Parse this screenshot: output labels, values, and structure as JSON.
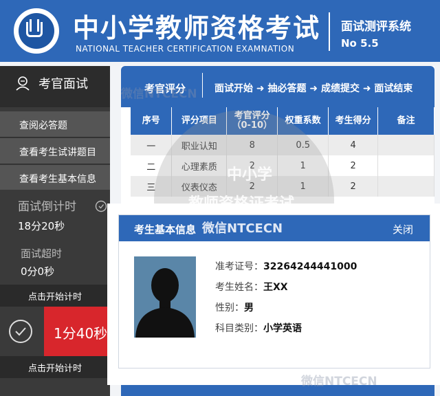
{
  "header": {
    "title_cn": "中小学教师资格考试",
    "title_en": "NATIONAL TEACHER CERTIFICATION EXAMNATION",
    "system_name": "面试测评系统",
    "version": "No 5.5"
  },
  "sidebar": {
    "title": "考官面试",
    "items": [
      {
        "label": "查阅必答题"
      },
      {
        "label": "查看考生试讲题目"
      },
      {
        "label": "查看考生基本信息"
      }
    ],
    "countdown_label": "面试倒计时",
    "countdown_value": "18分20秒",
    "overtime_label": "面试超时",
    "overtime_value": "0分0秒",
    "start_button_1": "点击开始计时",
    "timer_value": "1分40秒",
    "start_button_2": "点击开始计时"
  },
  "panel": {
    "title": "考官评分",
    "steps": "面试开始 ➜ 抽必答题 ➜ 成绩提交 ➜ 面试结束",
    "table": {
      "headers": [
        "序号",
        "评分项目",
        "考官评分",
        "（0-10）",
        "权重系数",
        "考生得分",
        "备注"
      ],
      "rows": [
        [
          "一",
          "职业认知",
          "8",
          "0.5",
          "4",
          ""
        ],
        [
          "二",
          "心理素质",
          "2",
          "1",
          "2",
          ""
        ],
        [
          "三",
          "仪表仪态",
          "2",
          "1",
          "2",
          ""
        ]
      ]
    }
  },
  "modal": {
    "title": "考生基本信息",
    "close_label": "关闭",
    "fields": [
      {
        "key": "准考证号：",
        "value": "32264244441000"
      },
      {
        "key": "考生姓名：",
        "value": "王XX"
      },
      {
        "key": "性别：",
        "value": "男"
      },
      {
        "key": "科目类别：",
        "value": "小学英语"
      }
    ]
  },
  "watermark": {
    "line1": "中小学",
    "line2": "教师资格证考试",
    "line3": "微信NTCECN",
    "top": "微信NTCECN",
    "bottom": "微信NTCECN"
  },
  "colors": {
    "brand_blue": "#2e68b8",
    "sidebar_dark": "#3a3a3a",
    "timer_red": "#d8262c"
  }
}
